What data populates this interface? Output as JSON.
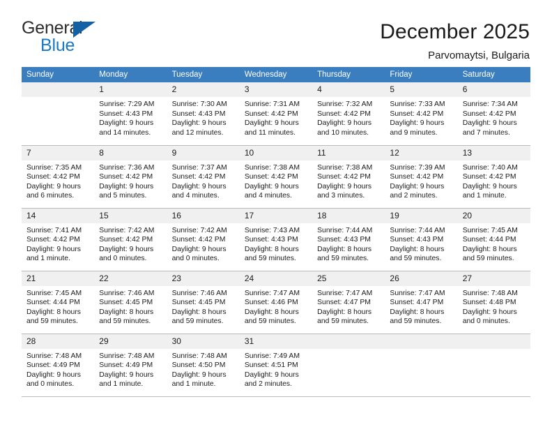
{
  "brand": {
    "name_top": "General",
    "name_bottom": "Blue",
    "triangle_color": "#1361a5",
    "blue_color": "#1b79c4"
  },
  "header": {
    "title": "December 2025",
    "subtitle": "Parvomaytsi, Bulgaria"
  },
  "theme": {
    "header_row_bg": "#3a7ebf",
    "daynum_bg": "#f0f0f0",
    "grid_line": "#b9b9b9"
  },
  "weekday_headers": [
    "Sunday",
    "Monday",
    "Tuesday",
    "Wednesday",
    "Thursday",
    "Friday",
    "Saturday"
  ],
  "weeks": [
    [
      {
        "empty": true
      },
      {
        "day": "1",
        "sunrise": "Sunrise: 7:29 AM",
        "sunset": "Sunset: 4:43 PM",
        "daylight1": "Daylight: 9 hours",
        "daylight2": "and 14 minutes."
      },
      {
        "day": "2",
        "sunrise": "Sunrise: 7:30 AM",
        "sunset": "Sunset: 4:43 PM",
        "daylight1": "Daylight: 9 hours",
        "daylight2": "and 12 minutes."
      },
      {
        "day": "3",
        "sunrise": "Sunrise: 7:31 AM",
        "sunset": "Sunset: 4:42 PM",
        "daylight1": "Daylight: 9 hours",
        "daylight2": "and 11 minutes."
      },
      {
        "day": "4",
        "sunrise": "Sunrise: 7:32 AM",
        "sunset": "Sunset: 4:42 PM",
        "daylight1": "Daylight: 9 hours",
        "daylight2": "and 10 minutes."
      },
      {
        "day": "5",
        "sunrise": "Sunrise: 7:33 AM",
        "sunset": "Sunset: 4:42 PM",
        "daylight1": "Daylight: 9 hours",
        "daylight2": "and 9 minutes."
      },
      {
        "day": "6",
        "sunrise": "Sunrise: 7:34 AM",
        "sunset": "Sunset: 4:42 PM",
        "daylight1": "Daylight: 9 hours",
        "daylight2": "and 7 minutes."
      }
    ],
    [
      {
        "day": "7",
        "sunrise": "Sunrise: 7:35 AM",
        "sunset": "Sunset: 4:42 PM",
        "daylight1": "Daylight: 9 hours",
        "daylight2": "and 6 minutes."
      },
      {
        "day": "8",
        "sunrise": "Sunrise: 7:36 AM",
        "sunset": "Sunset: 4:42 PM",
        "daylight1": "Daylight: 9 hours",
        "daylight2": "and 5 minutes."
      },
      {
        "day": "9",
        "sunrise": "Sunrise: 7:37 AM",
        "sunset": "Sunset: 4:42 PM",
        "daylight1": "Daylight: 9 hours",
        "daylight2": "and 4 minutes."
      },
      {
        "day": "10",
        "sunrise": "Sunrise: 7:38 AM",
        "sunset": "Sunset: 4:42 PM",
        "daylight1": "Daylight: 9 hours",
        "daylight2": "and 4 minutes."
      },
      {
        "day": "11",
        "sunrise": "Sunrise: 7:38 AM",
        "sunset": "Sunset: 4:42 PM",
        "daylight1": "Daylight: 9 hours",
        "daylight2": "and 3 minutes."
      },
      {
        "day": "12",
        "sunrise": "Sunrise: 7:39 AM",
        "sunset": "Sunset: 4:42 PM",
        "daylight1": "Daylight: 9 hours",
        "daylight2": "and 2 minutes."
      },
      {
        "day": "13",
        "sunrise": "Sunrise: 7:40 AM",
        "sunset": "Sunset: 4:42 PM",
        "daylight1": "Daylight: 9 hours",
        "daylight2": "and 1 minute."
      }
    ],
    [
      {
        "day": "14",
        "sunrise": "Sunrise: 7:41 AM",
        "sunset": "Sunset: 4:42 PM",
        "daylight1": "Daylight: 9 hours",
        "daylight2": "and 1 minute."
      },
      {
        "day": "15",
        "sunrise": "Sunrise: 7:42 AM",
        "sunset": "Sunset: 4:42 PM",
        "daylight1": "Daylight: 9 hours",
        "daylight2": "and 0 minutes."
      },
      {
        "day": "16",
        "sunrise": "Sunrise: 7:42 AM",
        "sunset": "Sunset: 4:42 PM",
        "daylight1": "Daylight: 9 hours",
        "daylight2": "and 0 minutes."
      },
      {
        "day": "17",
        "sunrise": "Sunrise: 7:43 AM",
        "sunset": "Sunset: 4:43 PM",
        "daylight1": "Daylight: 8 hours",
        "daylight2": "and 59 minutes."
      },
      {
        "day": "18",
        "sunrise": "Sunrise: 7:44 AM",
        "sunset": "Sunset: 4:43 PM",
        "daylight1": "Daylight: 8 hours",
        "daylight2": "and 59 minutes."
      },
      {
        "day": "19",
        "sunrise": "Sunrise: 7:44 AM",
        "sunset": "Sunset: 4:43 PM",
        "daylight1": "Daylight: 8 hours",
        "daylight2": "and 59 minutes."
      },
      {
        "day": "20",
        "sunrise": "Sunrise: 7:45 AM",
        "sunset": "Sunset: 4:44 PM",
        "daylight1": "Daylight: 8 hours",
        "daylight2": "and 59 minutes."
      }
    ],
    [
      {
        "day": "21",
        "sunrise": "Sunrise: 7:45 AM",
        "sunset": "Sunset: 4:44 PM",
        "daylight1": "Daylight: 8 hours",
        "daylight2": "and 59 minutes."
      },
      {
        "day": "22",
        "sunrise": "Sunrise: 7:46 AM",
        "sunset": "Sunset: 4:45 PM",
        "daylight1": "Daylight: 8 hours",
        "daylight2": "and 59 minutes."
      },
      {
        "day": "23",
        "sunrise": "Sunrise: 7:46 AM",
        "sunset": "Sunset: 4:45 PM",
        "daylight1": "Daylight: 8 hours",
        "daylight2": "and 59 minutes."
      },
      {
        "day": "24",
        "sunrise": "Sunrise: 7:47 AM",
        "sunset": "Sunset: 4:46 PM",
        "daylight1": "Daylight: 8 hours",
        "daylight2": "and 59 minutes."
      },
      {
        "day": "25",
        "sunrise": "Sunrise: 7:47 AM",
        "sunset": "Sunset: 4:47 PM",
        "daylight1": "Daylight: 8 hours",
        "daylight2": "and 59 minutes."
      },
      {
        "day": "26",
        "sunrise": "Sunrise: 7:47 AM",
        "sunset": "Sunset: 4:47 PM",
        "daylight1": "Daylight: 8 hours",
        "daylight2": "and 59 minutes."
      },
      {
        "day": "27",
        "sunrise": "Sunrise: 7:48 AM",
        "sunset": "Sunset: 4:48 PM",
        "daylight1": "Daylight: 9 hours",
        "daylight2": "and 0 minutes."
      }
    ],
    [
      {
        "day": "28",
        "sunrise": "Sunrise: 7:48 AM",
        "sunset": "Sunset: 4:49 PM",
        "daylight1": "Daylight: 9 hours",
        "daylight2": "and 0 minutes."
      },
      {
        "day": "29",
        "sunrise": "Sunrise: 7:48 AM",
        "sunset": "Sunset: 4:49 PM",
        "daylight1": "Daylight: 9 hours",
        "daylight2": "and 1 minute."
      },
      {
        "day": "30",
        "sunrise": "Sunrise: 7:48 AM",
        "sunset": "Sunset: 4:50 PM",
        "daylight1": "Daylight: 9 hours",
        "daylight2": "and 1 minute."
      },
      {
        "day": "31",
        "sunrise": "Sunrise: 7:49 AM",
        "sunset": "Sunset: 4:51 PM",
        "daylight1": "Daylight: 9 hours",
        "daylight2": "and 2 minutes."
      },
      {
        "empty": true
      },
      {
        "empty": true
      },
      {
        "empty": true
      }
    ]
  ]
}
